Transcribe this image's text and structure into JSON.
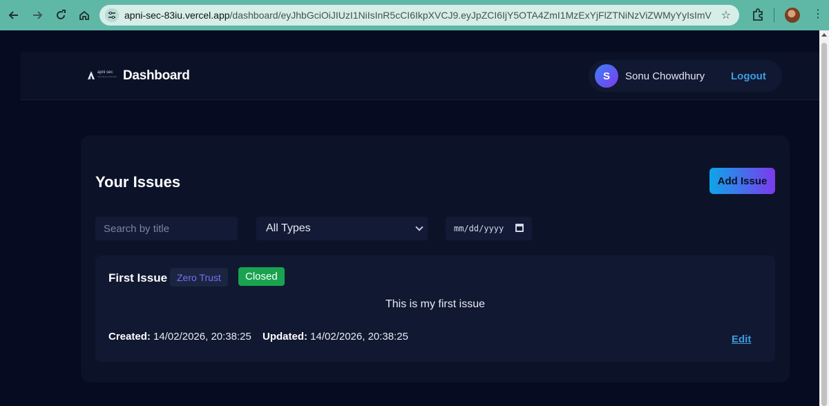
{
  "browser": {
    "url_host": "apni-sec-83iu.vercel.app",
    "url_path": "/dashboard/eyJhbGciOiJIUzI1NiIsInR5cCI6IkpXVCJ9.eyJpZCI6IjY5OTA4ZmI1MzExYjFlZTNiNzViZWMyYyIsImVtYWlsIjoicnJk..."
  },
  "header": {
    "logo_text": "apni sec",
    "logo_tagline": "Security as a Service",
    "title": "Dashboard",
    "user_initial": "S",
    "user_name": "Sonu Chowdhury",
    "logout_label": "Logout"
  },
  "issues": {
    "heading": "Your Issues",
    "add_label": "Add Issue",
    "search_placeholder": "Search by title",
    "type_filter": "All Types",
    "date_placeholder": "mm/dd/yyyy",
    "items": [
      {
        "title": "First Issue",
        "type": "Zero Trust",
        "status": "Closed",
        "description": "This is my first issue",
        "created_label": "Created:",
        "created": "14/02/2026, 20:38:25",
        "updated_label": "Updated:",
        "updated": "14/02/2026, 20:38:25",
        "edit_label": "Edit"
      }
    ]
  },
  "colors": {
    "accent": "#3b9ee0",
    "status_closed": "#19a34f",
    "type_badge_text": "#7c6cf0"
  }
}
